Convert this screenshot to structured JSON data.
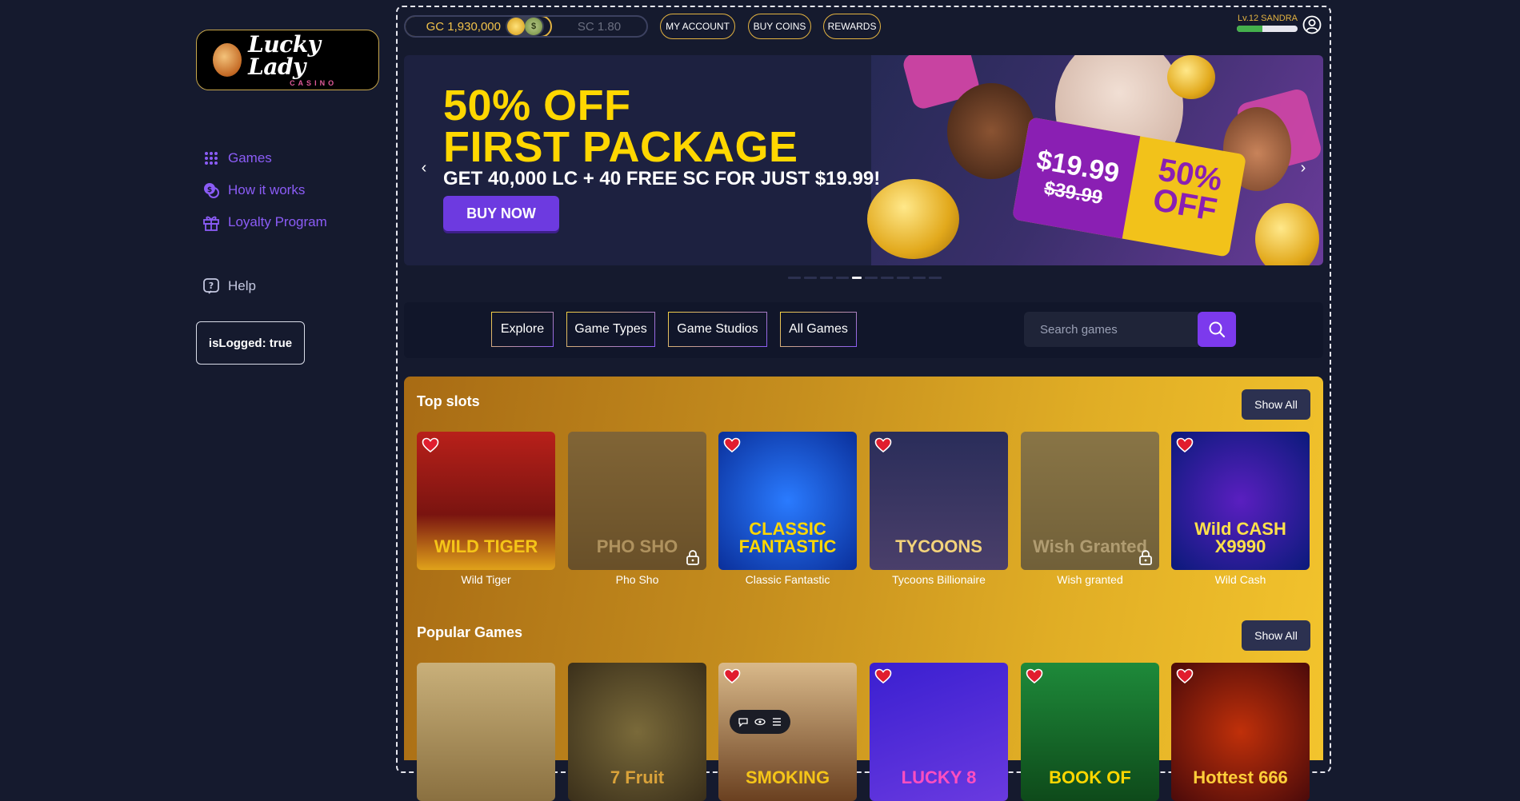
{
  "sidebar": {
    "logo": {
      "main": "Lucky Lady",
      "sub": "CASINO"
    },
    "nav": [
      {
        "label": "Games",
        "icon": "grid-icon"
      },
      {
        "label": "How it works",
        "icon": "coin-icon"
      },
      {
        "label": "Loyalty Program",
        "icon": "gift-icon"
      }
    ],
    "help": {
      "label": "Help",
      "icon": "question-icon"
    },
    "status": "isLogged: true"
  },
  "header": {
    "gc_balance": "GC 1,930,000",
    "sc_balance": "SC 1.80",
    "buttons": [
      "MY ACCOUNT",
      "BUY COINS",
      "REWARDS"
    ],
    "user_level": "Lv.12 SANDRA",
    "level_progress": 0.42
  },
  "banner": {
    "headline_1": "50% OFF",
    "headline_2": "FIRST PACKAGE",
    "subline": "GET 40,000 LC + 40 FREE SC FOR JUST $19.99!",
    "cta": "BUY NOW",
    "price": "$19.99",
    "old_price": "$39.99",
    "discount_line1": "50%",
    "discount_line2": "OFF",
    "slides_count": 10,
    "active_slide": 4
  },
  "filters": {
    "tabs": [
      "Explore",
      "Game Types",
      "Game Studios",
      "All Games"
    ],
    "search_placeholder": "Search games"
  },
  "sections": [
    {
      "title": "Top slots",
      "show_all": "Show All",
      "games": [
        {
          "name": "Wild Tiger",
          "art": "WILD TIGER",
          "favorite": true,
          "locked": false
        },
        {
          "name": "Pho Sho",
          "art": "PHO SHO",
          "favorite": false,
          "locked": true
        },
        {
          "name": "Classic Fantastic",
          "art": "CLASSIC FANTASTIC",
          "favorite": true,
          "locked": false
        },
        {
          "name": "Tycoons Billionaire",
          "art": "TYCOONS",
          "favorite": true,
          "locked": false
        },
        {
          "name": "Wish granted",
          "art": "Wish Granted",
          "favorite": false,
          "locked": true
        },
        {
          "name": "Wild Cash",
          "art": "Wild CASH X9990",
          "favorite": true,
          "locked": false
        }
      ]
    },
    {
      "title": "Popular Games",
      "show_all": "Show All",
      "games": [
        {
          "name": "",
          "art": "",
          "favorite": false,
          "locked": false
        },
        {
          "name": "",
          "art": "7 Fruit",
          "favorite": false,
          "locked": false
        },
        {
          "name": "",
          "art": "SMOKING",
          "favorite": true,
          "locked": false
        },
        {
          "name": "",
          "art": "LUCKY 8",
          "favorite": true,
          "locked": false
        },
        {
          "name": "",
          "art": "BOOK OF",
          "favorite": true,
          "locked": false
        },
        {
          "name": "",
          "art": "Hottest 666",
          "favorite": true,
          "locked": false
        }
      ]
    }
  ],
  "colors": {
    "accent": "#8b5cf6",
    "gold": "#e3b341",
    "heart": "#e11d2e",
    "background": "#151a2e"
  }
}
